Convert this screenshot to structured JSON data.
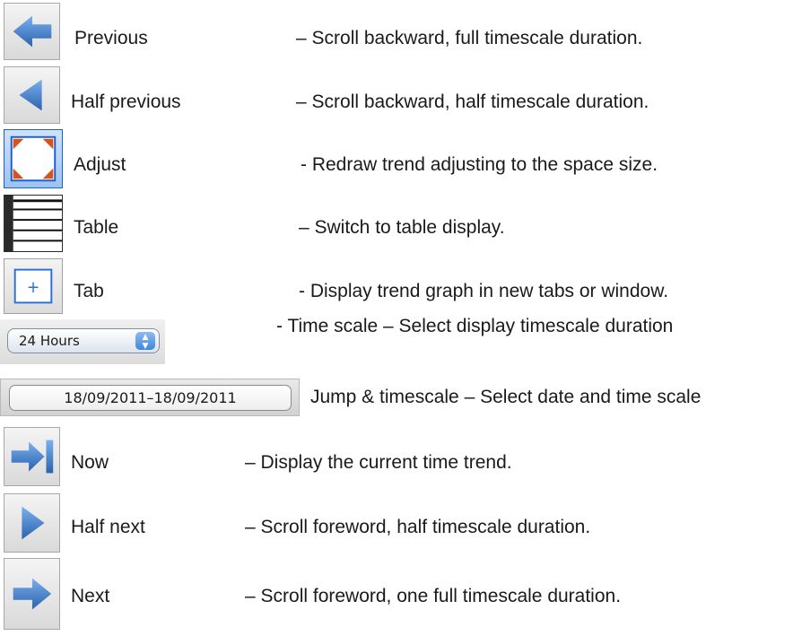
{
  "items": [
    {
      "icon": "arrow-left-icon",
      "label": "Previous",
      "description": "– Scroll backward, full timescale duration."
    },
    {
      "icon": "triangle-left-icon",
      "label": "Half previous",
      "description": "– Scroll backward, half timescale duration."
    },
    {
      "icon": "adjust-frame-icon",
      "label": "Adjust",
      "description": "- Redraw trend adjusting to the space size."
    },
    {
      "icon": "table-icon",
      "label": "Table",
      "description": "– Switch to table display."
    },
    {
      "icon": "new-tab-icon",
      "label": "Tab",
      "description": "- Display trend graph in new tabs or window."
    },
    {
      "icon": "timescale-select",
      "label": "",
      "description": "- Time scale – Select display timescale duration"
    },
    {
      "icon": "date-range-field",
      "label": "Jump & timescale",
      "description": "– Select date and time scale"
    },
    {
      "icon": "arrow-right-bar-icon",
      "label": "Now",
      "description": "– Display the current time trend."
    },
    {
      "icon": "triangle-right-icon",
      "label": "Half next",
      "description": "– Scroll foreword, half timescale duration."
    },
    {
      "icon": "arrow-right-icon",
      "label": "Next",
      "description": "– Scroll foreword, one full timescale duration."
    }
  ],
  "timescale_select": {
    "value": "24 Hours",
    "stepper_up": "▲",
    "stepper_down": "▼"
  },
  "date_range_field": {
    "value": "18/09/2011–18/09/2011"
  },
  "tab_icon_glyph": "+",
  "colors": {
    "arrow_blue": "#2f6db8",
    "arrow_blue_light": "#6aa3e6",
    "adjust_orange": "#d4541c"
  }
}
